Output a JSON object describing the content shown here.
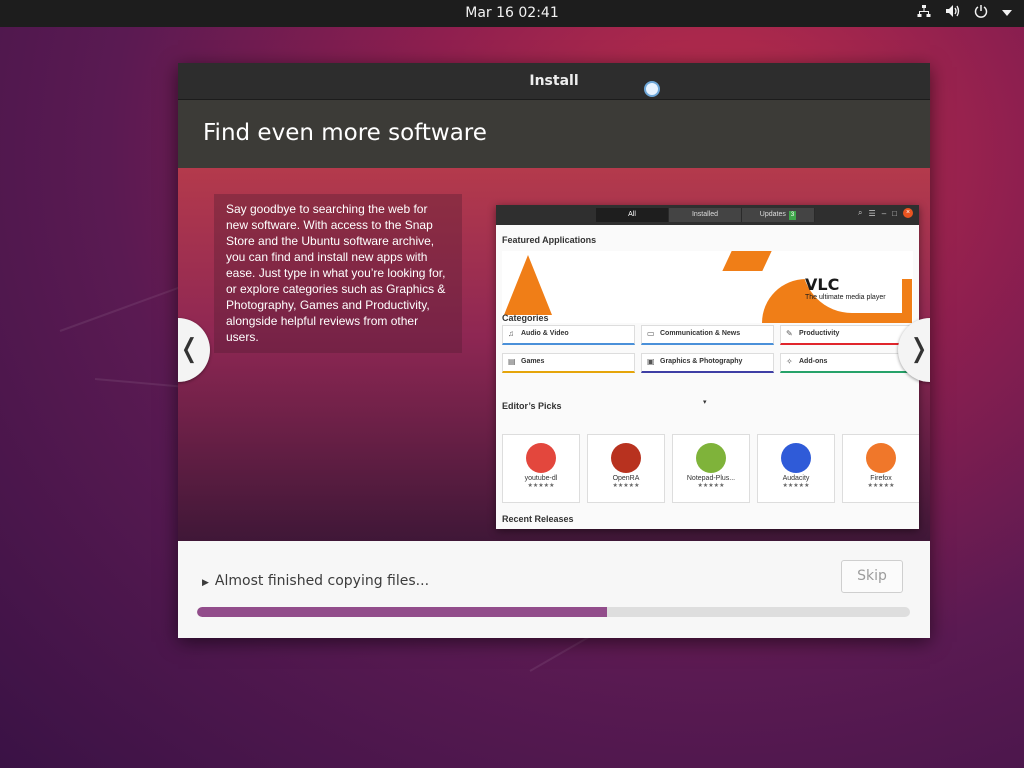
{
  "topbar": {
    "clock": "Mar 16  02:41",
    "icons": [
      "network-icon",
      "volume-icon",
      "power-icon",
      "menu-arrow-icon"
    ]
  },
  "window": {
    "title": "Install",
    "heading": "Find even more software",
    "description": "Say goodbye to searching the web for new software. With access to the Snap Store and the Ubuntu software archive, you can find and install new apps with ease. Just type in what you’re looking for, or explore categories such as Graphics & Photography, Games and Productivity, alongside helpful reviews from other users.",
    "prev_label": "❬",
    "next_label": "❭",
    "store_preview": {
      "tabs": [
        "All",
        "Installed",
        "Updates"
      ],
      "updates_badge": "3",
      "featured_heading": "Featured Applications",
      "featured_title": "VLC",
      "featured_subtitle": "The ultimate media player",
      "categories_heading": "Categories",
      "categories": [
        {
          "label": "Audio & Video",
          "icon": "music-icon",
          "color": "#4a90d9"
        },
        {
          "label": "Communication & News",
          "icon": "chat-icon",
          "color": "#4a90d9"
        },
        {
          "label": "Productivity",
          "icon": "edit-icon",
          "color": "#e0262c"
        },
        {
          "label": "Games",
          "icon": "game-icon",
          "color": "#e5a50a"
        },
        {
          "label": "Graphics & Photography",
          "icon": "image-icon",
          "color": "#3f3fa5"
        },
        {
          "label": "Add-ons",
          "icon": "puzzle-icon",
          "color": "#26a269"
        }
      ],
      "picks_heading": "Editor’s Picks",
      "picks": [
        {
          "name": "youtube-dl",
          "stars": "★★★★★",
          "color": "#e3473d"
        },
        {
          "name": "OpenRA",
          "stars": "★★★★★",
          "color": "#b8321f"
        },
        {
          "name": "Notepad-Plus...",
          "stars": "★★★★★",
          "color": "#7fb33a"
        },
        {
          "name": "Audacity",
          "stars": "★★★★★",
          "color": "#2f5bd8"
        },
        {
          "name": "Firefox",
          "stars": "★★★★★",
          "color": "#f0772a"
        }
      ],
      "recent_heading": "Recent Releases"
    }
  },
  "footer": {
    "status": "Almost finished copying files...",
    "skip_label": "Skip",
    "progress": 0.575,
    "progress_color": "#924d8b"
  }
}
